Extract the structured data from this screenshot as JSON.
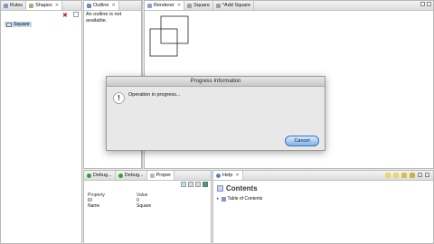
{
  "rules_panel": {
    "tabs": [
      {
        "label": "Rules"
      },
      {
        "label": "Shapes"
      }
    ],
    "tree_item": "Square"
  },
  "outline_panel": {
    "tab": "Outline",
    "message": "An outline is not available."
  },
  "editor": {
    "tabs": [
      {
        "label": "Renderer"
      },
      {
        "label": "Square"
      },
      {
        "label": "*Add Square"
      }
    ]
  },
  "dialog": {
    "title": "Progress Information",
    "message": "Operation in progress...",
    "cancel_label": "Cancel",
    "icon_glyph": "!"
  },
  "bottom_left": {
    "tabs": [
      {
        "label": "Debug..."
      },
      {
        "label": "Debug..."
      },
      {
        "label": "Proper"
      }
    ],
    "columns": [
      "Property",
      "Value"
    ],
    "rows": [
      {
        "property": "ID",
        "value": "0"
      },
      {
        "property": "Name",
        "value": "Square"
      }
    ]
  },
  "help_panel": {
    "tab": "Help",
    "heading": "Contents",
    "item": "Table of Contents"
  },
  "colors": {
    "cancel_button": "#7fb1ea",
    "close_red": "#d02020"
  }
}
